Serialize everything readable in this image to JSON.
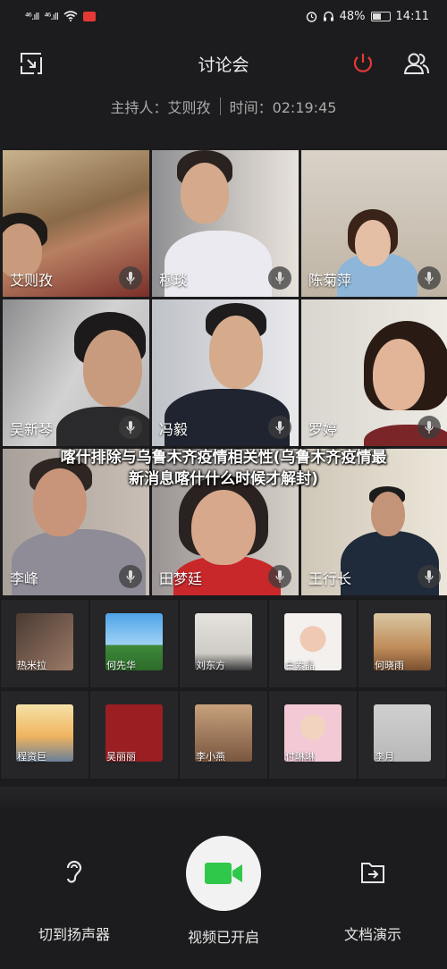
{
  "status_bar": {
    "sig1": "⁴⁶.ıll",
    "sig2": "⁴⁶.ıll",
    "battery": "48%",
    "time": "14:11"
  },
  "header": {
    "title": "讨论会"
  },
  "info": {
    "host": "主持人：艾则孜",
    "time": "时间：02:19:45"
  },
  "video_tiles": [
    {
      "name": "艾则孜"
    },
    {
      "name": "穆琰"
    },
    {
      "name": "陈菊萍"
    },
    {
      "name": "吴新琴"
    },
    {
      "name": "冯毅"
    },
    {
      "name": "罗婷"
    },
    {
      "name": "李峰"
    },
    {
      "name": "田梦廷"
    },
    {
      "name": "王行长"
    }
  ],
  "caption": "喀什排除与乌鲁木齐疫情相关性(乌鲁木齐疫情最新消息喀什什么时候才解封)",
  "participants": [
    {
      "name": "热米拉"
    },
    {
      "name": "何先华"
    },
    {
      "name": "刘东方"
    },
    {
      "name": "白素晶"
    },
    {
      "name": "何晓雨"
    },
    {
      "name": "程资巨"
    },
    {
      "name": "吴丽丽"
    },
    {
      "name": "李小燕"
    },
    {
      "name": "付琳琳"
    },
    {
      "name": "李月"
    }
  ],
  "bottom_bar": {
    "speaker_label": "切到扬声器",
    "video_label": "视频已开启",
    "doc_label": "文档演示"
  },
  "colors": {
    "accent_red": "#e53935",
    "video_green": "#2fc84a",
    "background": "#1c1c1e"
  }
}
